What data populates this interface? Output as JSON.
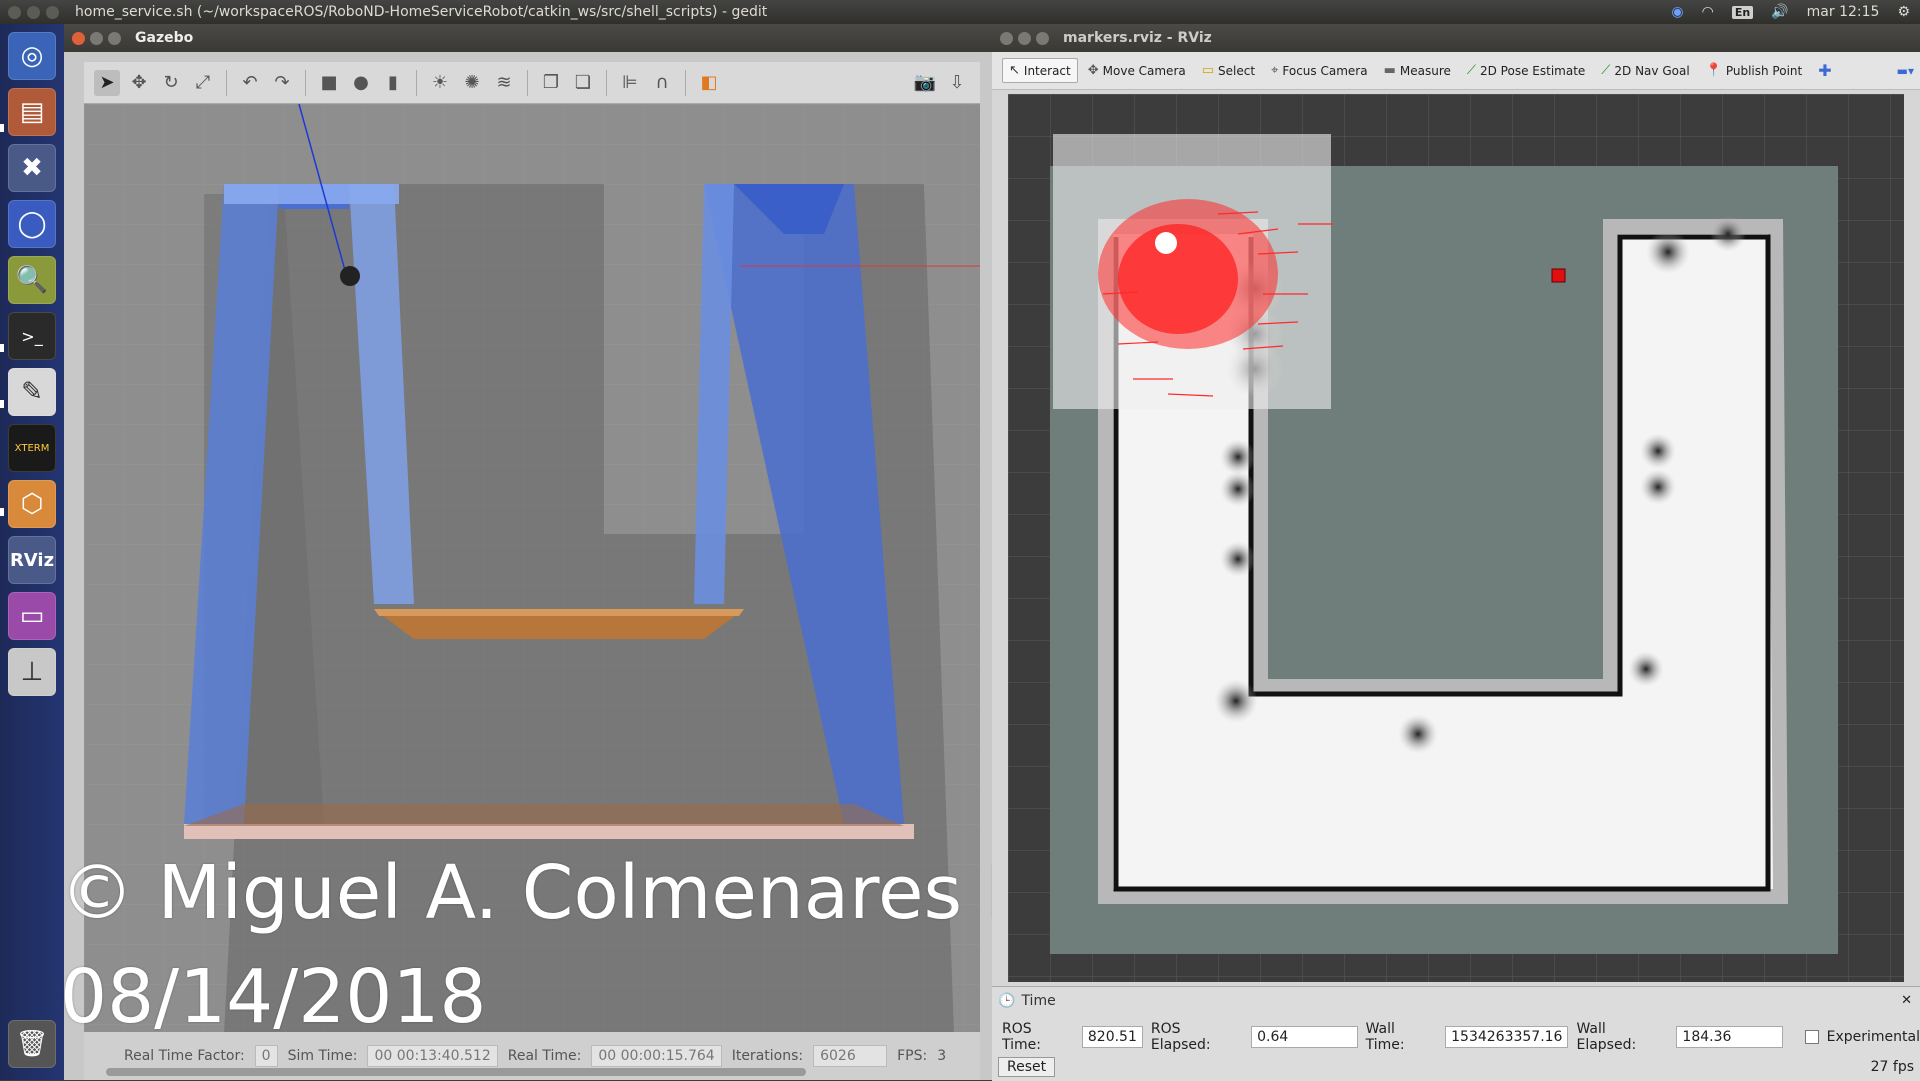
{
  "topbar": {
    "window_title": "home_service.sh (~/workspaceROS/RoboND-HomeServiceRobot/catkin_ws/src/shell_scripts) - gedit",
    "lang": "En",
    "clock": "mar 12:15"
  },
  "launcher": {
    "items": [
      "ubuntu-dash-icon",
      "files-icon",
      "settings-icon",
      "chromium-icon",
      "search-tool-icon",
      "terminal-icon",
      "text-editor-icon",
      "xterm-icon",
      "gazebo-icon",
      "rviz-icon",
      "window-icon",
      "scanner-icon",
      "trash-icon"
    ],
    "xterm_label": "XTERM",
    "rviz_label": "RViz"
  },
  "gazebo": {
    "title": "Gazebo",
    "status": {
      "real_time_factor_label": "Real Time Factor:",
      "real_time_factor": "0",
      "sim_time_label": "Sim Time:",
      "sim_time": "00 00:13:40.512",
      "real_time_label": "Real Time:",
      "real_time": "00 00:00:15.764",
      "iterations_label": "Iterations:",
      "iterations": "6026",
      "fps_label": "FPS:",
      "fps": "3"
    }
  },
  "watermark": {
    "line1": "© Miguel A. Colmenares B.",
    "line2": "08/14/2018"
  },
  "rviz": {
    "title": "markers.rviz - RViz",
    "tools": [
      {
        "label": "Interact",
        "icon": "cursor-icon"
      },
      {
        "label": "Move Camera",
        "icon": "move-camera-icon"
      },
      {
        "label": "Select",
        "icon": "select-icon"
      },
      {
        "label": "Focus Camera",
        "icon": "focus-camera-icon"
      },
      {
        "label": "Measure",
        "icon": "measure-icon"
      },
      {
        "label": "2D Pose Estimate",
        "icon": "pose-estimate-icon"
      },
      {
        "label": "2D Nav Goal",
        "icon": "nav-goal-icon"
      },
      {
        "label": "Publish Point",
        "icon": "publish-point-icon"
      }
    ],
    "time_panel": {
      "header": "Time",
      "ros_time_label": "ROS Time:",
      "ros_time": "820.51",
      "ros_elapsed_label": "ROS Elapsed:",
      "ros_elapsed": "0.64",
      "wall_time_label": "Wall Time:",
      "wall_time": "1534263357.16",
      "wall_elapsed_label": "Wall Elapsed:",
      "wall_elapsed": "184.36",
      "experimental_label": "Experimental",
      "experimental_checked": false,
      "reset_label": "Reset",
      "fps": "27 fps"
    }
  },
  "colors": {
    "launcher_bg": "#243571",
    "wall_blue": "#4a6fd0",
    "marker_red": "#e01010",
    "particles_red": "#ff2a2a",
    "map_bg": "#6f7e7a"
  }
}
